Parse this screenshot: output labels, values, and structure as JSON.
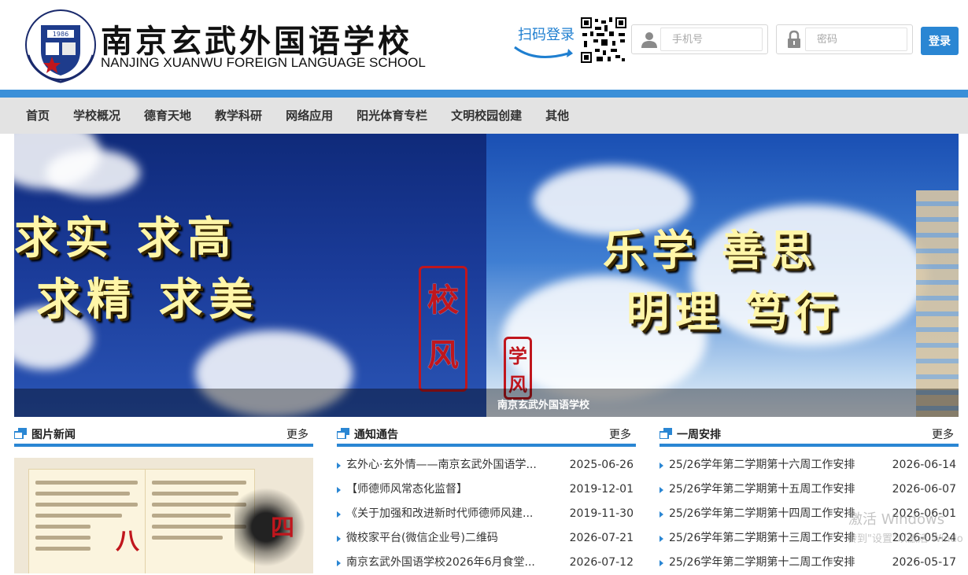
{
  "header": {
    "school_name_cn": "南京玄武外国语学校",
    "school_name_en": "NANJING XUANWU FOREIGN LANGUAGE SCHOOL",
    "seal_text": "1986",
    "scan_login": "扫码登录",
    "phone_placeholder": "手机号",
    "password_placeholder": "密码",
    "login_button": "登录"
  },
  "nav": {
    "items": [
      "首页",
      "学校概况",
      "德育天地",
      "教学科研",
      "网络应用",
      "阳光体育专栏",
      "文明校园创建",
      "其他"
    ]
  },
  "banner": {
    "left_line1": "求实 求高",
    "left_line2": "求精 求美",
    "left_stamp": "校风",
    "right_line1": "乐学 善思",
    "right_line2": "明理 笃行",
    "right_stamp": "学风",
    "caption": "南京玄武外国语学校"
  },
  "columns": {
    "pic_news": {
      "title": "图片新闻",
      "more": "更多",
      "red_chars": [
        "八",
        "四"
      ]
    },
    "notices": {
      "title": "通知通告",
      "more": "更多",
      "items": [
        {
          "title": "玄外心·玄外情——南京玄武外国语学...",
          "date": "2025-06-26"
        },
        {
          "title": "【师德师风常态化监督】",
          "date": "2019-12-01"
        },
        {
          "title": "《关于加强和改进新时代师德师风建...",
          "date": "2019-11-30"
        },
        {
          "title": "微校家平台(微信企业号)二维码",
          "date": "2026-07-21"
        },
        {
          "title": "南京玄武外国语学校2026年6月食堂...",
          "date": "2026-07-12"
        }
      ]
    },
    "weekly": {
      "title": "一周安排",
      "more": "更多",
      "items": [
        {
          "title": "25/26学年第二学期第十六周工作安排",
          "date": "2026-06-14"
        },
        {
          "title": "25/26学年第二学期第十五周工作安排",
          "date": "2026-06-07"
        },
        {
          "title": "25/26学年第二学期第十四周工作安排",
          "date": "2026-06-01"
        },
        {
          "title": "25/26学年第二学期第十三周工作安排",
          "date": "2026-05-24"
        },
        {
          "title": "25/26学年第二学期第十二周工作安排",
          "date": "2026-05-17"
        }
      ]
    }
  },
  "watermark": {
    "line1": "激活 Windows",
    "line2": "转到\"设置\"以激活 Windo"
  },
  "colors": {
    "accent": "#2a86d3",
    "nav_bg": "#e3e3e3",
    "stamp_red": "#c0161d"
  },
  "icons": [
    "user-icon",
    "lock-icon",
    "qr-code-icon",
    "section-icon",
    "triangle-bullet-icon"
  ]
}
